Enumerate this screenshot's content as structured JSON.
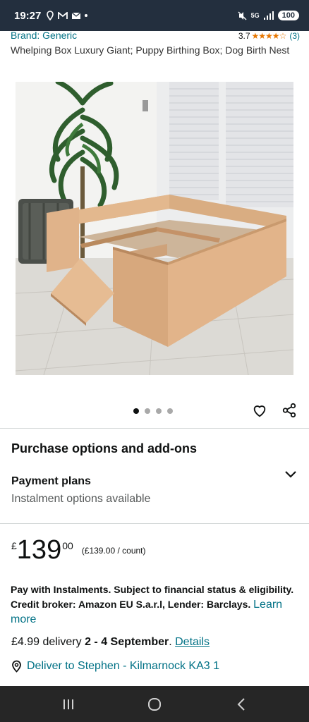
{
  "status_bar": {
    "time": "19:27",
    "network": "5G",
    "battery": "100"
  },
  "product": {
    "brand": "Brand: Generic",
    "rating_value": "3.7",
    "rating_stars": "★★★★☆",
    "rating_count": "(3)",
    "title": "Whelping Box Luxury Giant; Puppy Birthing Box; Dog Birth Nest"
  },
  "gallery": {
    "image_count": 4,
    "active_index": 0
  },
  "purchase": {
    "section_title": "Purchase options and add-ons",
    "payment_plans_title": "Payment plans",
    "payment_plans_subtitle": "Instalment options available"
  },
  "price": {
    "symbol": "£",
    "whole": "139",
    "fraction": "00",
    "per_unit": "(£139.00 / count)"
  },
  "instalments": {
    "text": "Pay with Instalments. Subject to financial status & eligibility. Credit broker: Amazon EU S.a.r.l, Lender: Barclays.",
    "learn_more": "Learn more"
  },
  "delivery": {
    "prefix": "£4.99 delivery",
    "dates": "2 - 4 September",
    "details_link": "Details",
    "deliver_to": "Deliver to Stephen - Kilmarnock KA3 1"
  },
  "colors": {
    "link": "#007185",
    "star": "#e77600",
    "status_bar": "#232f3e",
    "nav_bar": "#262626"
  }
}
